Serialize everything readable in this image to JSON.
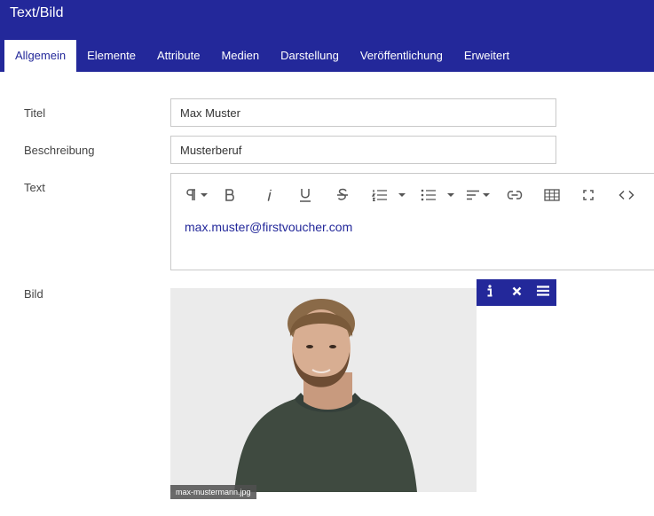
{
  "header": {
    "title": "Text/Bild"
  },
  "tabs": [
    {
      "label": "Allgemein",
      "active": true
    },
    {
      "label": "Elemente"
    },
    {
      "label": "Attribute"
    },
    {
      "label": "Medien"
    },
    {
      "label": "Darstellung"
    },
    {
      "label": "Veröffentlichung"
    },
    {
      "label": "Erweitert"
    }
  ],
  "form": {
    "titel": {
      "label": "Titel",
      "value": "Max Muster"
    },
    "beschreibung": {
      "label": "Beschreibung",
      "value": "Musterberuf"
    },
    "text": {
      "label": "Text",
      "content": "max.muster@firstvoucher.com",
      "toolbar": [
        "paragraph-icon",
        "bold-icon",
        "italic-icon",
        "underline-icon",
        "strikethrough-icon",
        "ordered-list-icon",
        "unordered-list-icon",
        "align-icon",
        "link-icon",
        "table-icon",
        "fullscreen-icon",
        "code-icon"
      ]
    },
    "bild": {
      "label": "Bild",
      "filename": "max-mustermann.jpg",
      "actions": [
        "info-icon",
        "remove-icon",
        "menu-icon"
      ]
    }
  },
  "colors": {
    "primary": "#23289a",
    "link": "#23289a"
  }
}
